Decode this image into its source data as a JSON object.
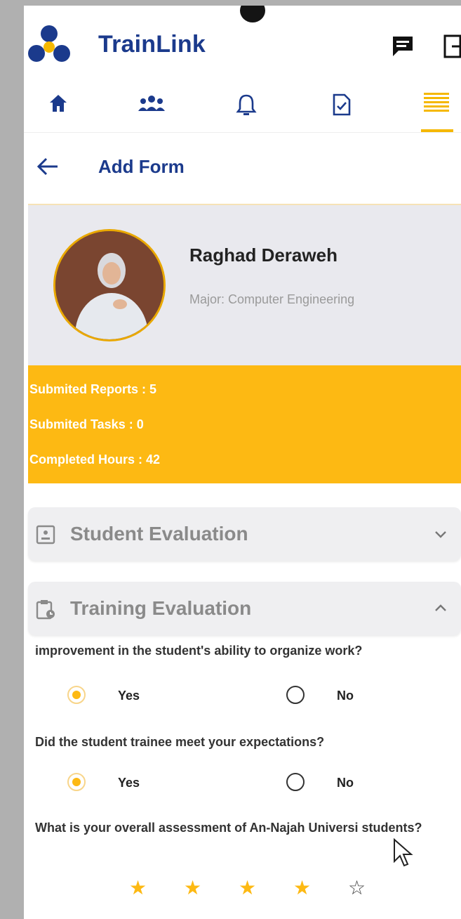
{
  "app": {
    "title": "TrainLink",
    "icons": {
      "logo": "trainlink-logo",
      "chat": "chat-icon",
      "logout": "logout-icon"
    }
  },
  "nav": {
    "items": [
      {
        "icon": "home-icon"
      },
      {
        "icon": "people-icon"
      },
      {
        "icon": "bell-icon"
      },
      {
        "icon": "report-check-icon"
      },
      {
        "icon": "menu-lines-icon",
        "active": true
      }
    ],
    "accent": "#f5b800"
  },
  "header": {
    "back_icon": "back-arrow-icon",
    "title": "Add Form"
  },
  "profile": {
    "name": "Raghad Deraweh",
    "major": "Major: Computer Engineering"
  },
  "stats": [
    "Submited Reports : 5",
    "Submited Tasks : 0",
    "Completed Hours : 42"
  ],
  "sections": {
    "student_eval": {
      "title": "Student Evaluation",
      "icon": "id-card-icon",
      "expanded": false
    },
    "training_eval": {
      "title": "Training Evaluation",
      "icon": "clipboard-clock-icon",
      "expanded": true
    }
  },
  "questions": [
    {
      "text": "improvement in the student's ability to organize work?",
      "yes": "Yes",
      "no": "No",
      "selected": "Yes"
    },
    {
      "text": "Did the student trainee meet your expectations?",
      "yes": "Yes",
      "no": "No",
      "selected": "Yes"
    },
    {
      "text": "What is your overall assessment of An-Najah Universi students?",
      "rating": 4,
      "max": 5
    }
  ],
  "colors": {
    "brand_blue": "#1b3a8c",
    "accent_yellow": "#fdb913"
  }
}
